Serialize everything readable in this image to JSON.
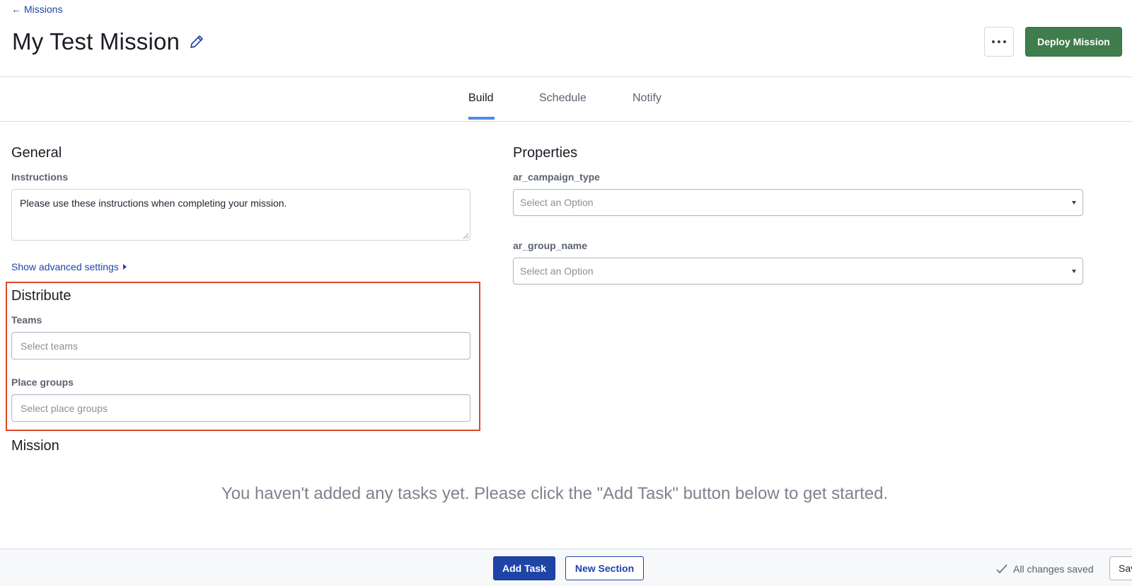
{
  "header": {
    "back_label": "Missions",
    "title": "My Test Mission",
    "deploy_label": "Deploy Mission"
  },
  "tabs": [
    {
      "label": "Build",
      "active": true
    },
    {
      "label": "Schedule",
      "active": false
    },
    {
      "label": "Notify",
      "active": false
    }
  ],
  "general": {
    "heading": "General",
    "instructions_label": "Instructions",
    "instructions_value": "Please use these instructions when completing your mission.",
    "advanced_link": "Show advanced settings"
  },
  "distribute": {
    "heading": "Distribute",
    "teams_label": "Teams",
    "teams_placeholder": "Select teams",
    "place_groups_label": "Place groups",
    "place_groups_placeholder": "Select place groups"
  },
  "properties": {
    "heading": "Properties",
    "fields": [
      {
        "label": "ar_campaign_type",
        "value": "Select an Option"
      },
      {
        "label": "ar_group_name",
        "value": "Select an Option"
      }
    ]
  },
  "mission": {
    "heading": "Mission",
    "empty_message": "You haven't added any tasks yet. Please click the \"Add Task\" button below to get started."
  },
  "footer": {
    "add_task_label": "Add Task",
    "new_section_label": "New Section",
    "status": "All changes saved",
    "save_label": "Sav"
  },
  "colors": {
    "link": "#1f44a8",
    "deploy": "#3f7d4d",
    "tab_underline": "#4f8be3",
    "highlight": "#e0472b"
  }
}
